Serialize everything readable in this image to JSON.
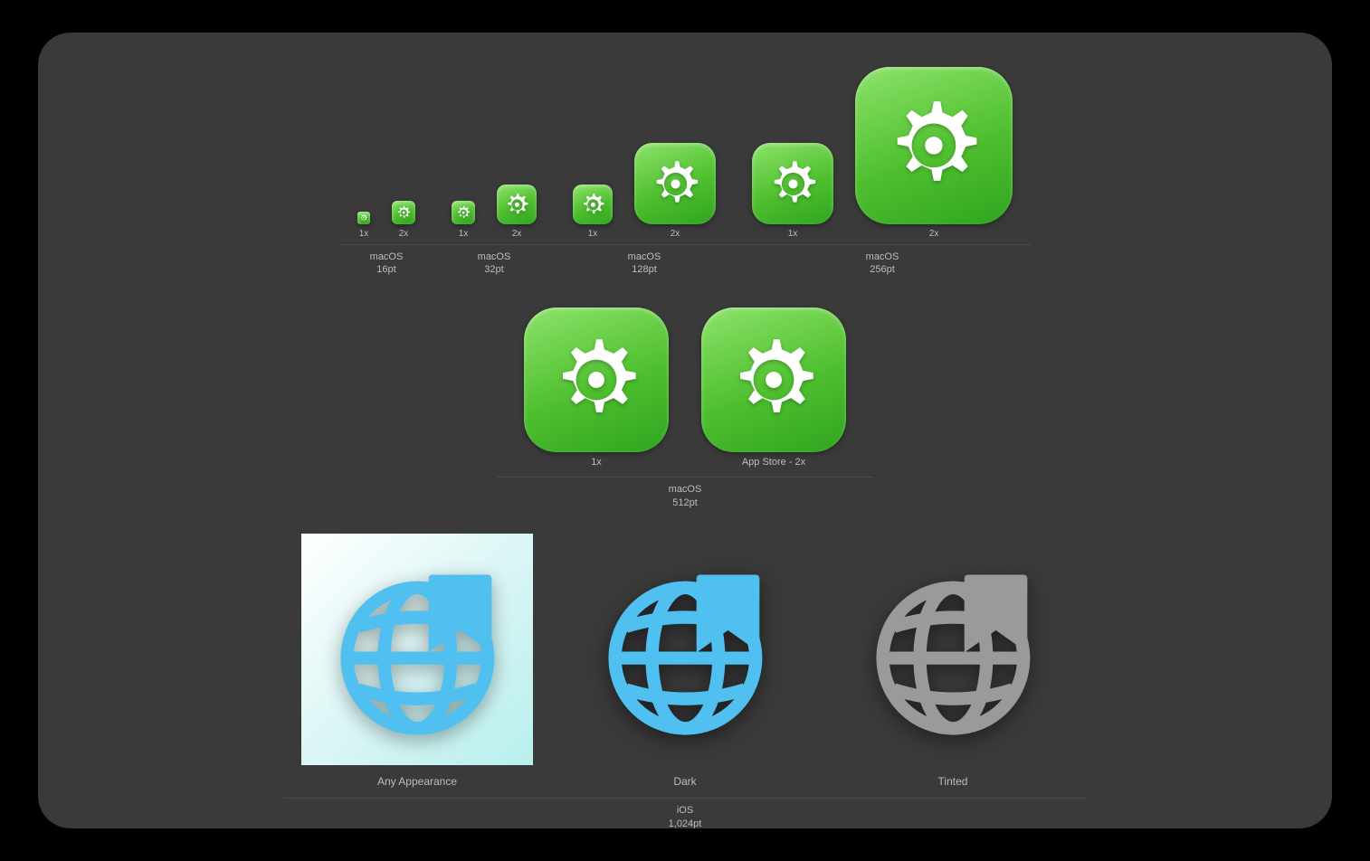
{
  "row1": {
    "groups": [
      {
        "os": "macOS",
        "pt": "16pt",
        "scales": [
          "1x",
          "2x"
        ]
      },
      {
        "os": "macOS",
        "pt": "32pt",
        "scales": [
          "1x",
          "2x"
        ]
      },
      {
        "os": "macOS",
        "pt": "128pt",
        "scales": [
          "1x",
          "2x"
        ]
      },
      {
        "os": "macOS",
        "pt": "256pt",
        "scales": [
          "1x",
          "2x"
        ]
      }
    ]
  },
  "row2": {
    "os": "macOS",
    "pt": "512pt",
    "scales": [
      "1x",
      "App Store - 2x"
    ]
  },
  "row3": {
    "os": "iOS",
    "pt": "1,024pt",
    "appearances": [
      "Any Appearance",
      "Dark",
      "Tinted"
    ]
  }
}
